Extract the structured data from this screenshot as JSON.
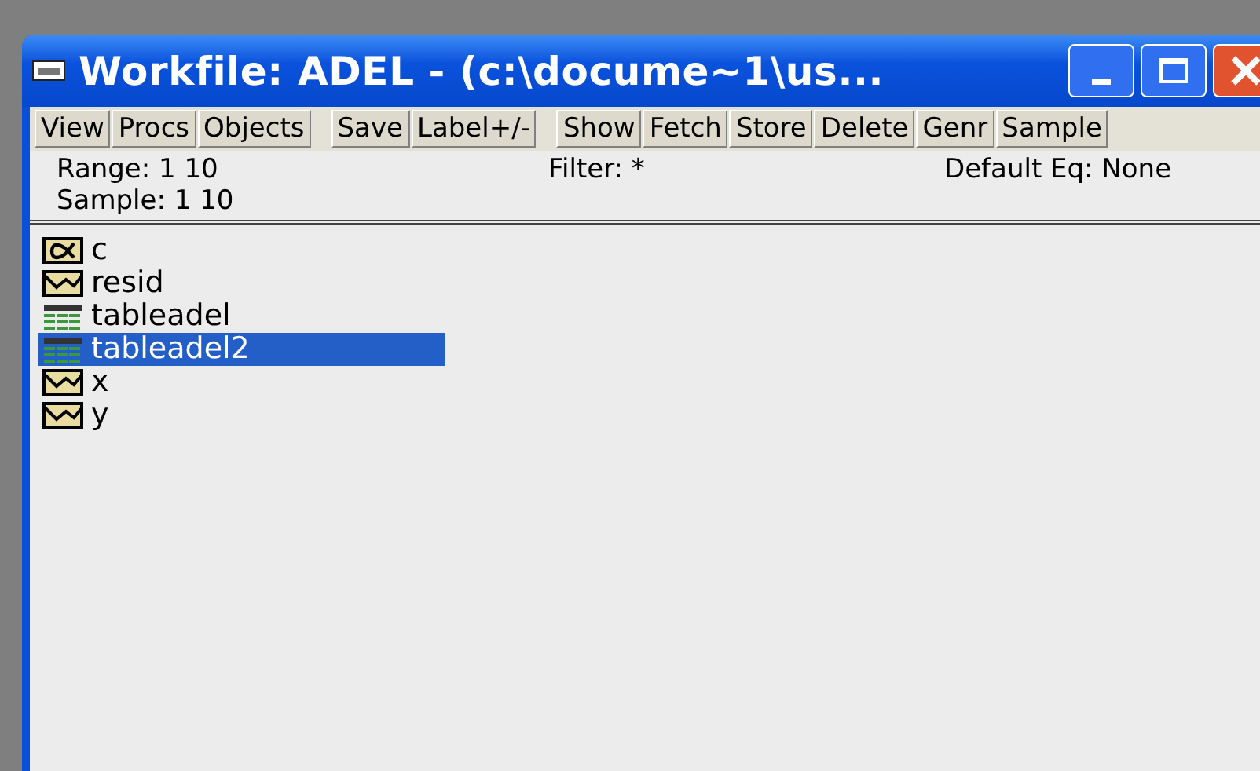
{
  "window": {
    "title": "Workfile: ADEL - (c:\\docume~1\\us..."
  },
  "toolbar": [
    [
      "View",
      "Procs",
      "Objects"
    ],
    [
      "Save",
      "Label+/-"
    ],
    [
      "Show",
      "Fetch",
      "Store",
      "Delete",
      "Genr",
      "Sample"
    ]
  ],
  "info": {
    "range": "Range:  1 10",
    "sample": "Sample: 1 10",
    "filter": "Filter: *",
    "default_eq": "Default Eq: None"
  },
  "objects": [
    {
      "name": "c",
      "kind": "coef",
      "selected": false
    },
    {
      "name": "resid",
      "kind": "series",
      "selected": false
    },
    {
      "name": "tableadel",
      "kind": "table",
      "selected": false
    },
    {
      "name": "tableadel2",
      "kind": "table",
      "selected": true
    },
    {
      "name": "x",
      "kind": "series",
      "selected": false
    },
    {
      "name": "y",
      "kind": "series",
      "selected": false
    }
  ]
}
